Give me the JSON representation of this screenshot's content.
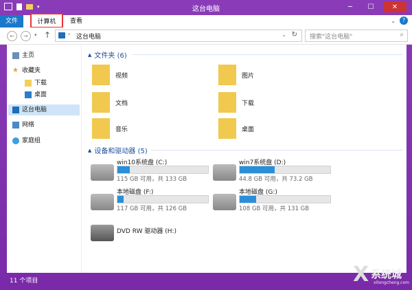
{
  "window": {
    "title": "这台电脑"
  },
  "ribbon": {
    "tabs": [
      {
        "label": "文件"
      },
      {
        "label": "计算机"
      },
      {
        "label": "查看"
      }
    ],
    "help": "?"
  },
  "address": {
    "crumb": "这台电脑",
    "search_placeholder": "搜索\"这台电脑\""
  },
  "sidebar": {
    "items": [
      {
        "label": "主页"
      },
      {
        "label": "收藏夹"
      },
      {
        "label": "下载"
      },
      {
        "label": "桌面"
      },
      {
        "label": "这台电脑"
      },
      {
        "label": "网络"
      },
      {
        "label": "家庭组"
      }
    ]
  },
  "folders_group": {
    "title": "文件夹 (6)",
    "items": [
      {
        "label": "视频"
      },
      {
        "label": "图片"
      },
      {
        "label": "文档"
      },
      {
        "label": "下载"
      },
      {
        "label": "音乐"
      },
      {
        "label": "桌面"
      }
    ]
  },
  "drives_group": {
    "title": "设备和驱动器 (5)",
    "drives": [
      {
        "name": "win10系统盘 (C:)",
        "info": "115 GB 可用，共 133 GB",
        "used": 0.14
      },
      {
        "name": "win7系统盘 (D:)",
        "info": "44.8 GB 可用，共 73.2 GB",
        "used": 0.39
      },
      {
        "name": "本地磁盘 (F:)",
        "info": "117 GB 可用，共 126 GB",
        "used": 0.07
      },
      {
        "name": "本地磁盘 (G:)",
        "info": "108 GB 可用，共 131 GB",
        "used": 0.18
      },
      {
        "name": "DVD RW 驱动器 (H:)"
      }
    ]
  },
  "status": {
    "count": "11 个项目"
  },
  "watermark": {
    "text": "系统城",
    "url": "xitongcheng.com"
  },
  "colors": {
    "accent": "#1979ca",
    "frame": "#7b2ea6",
    "highlight": "#e53333"
  }
}
